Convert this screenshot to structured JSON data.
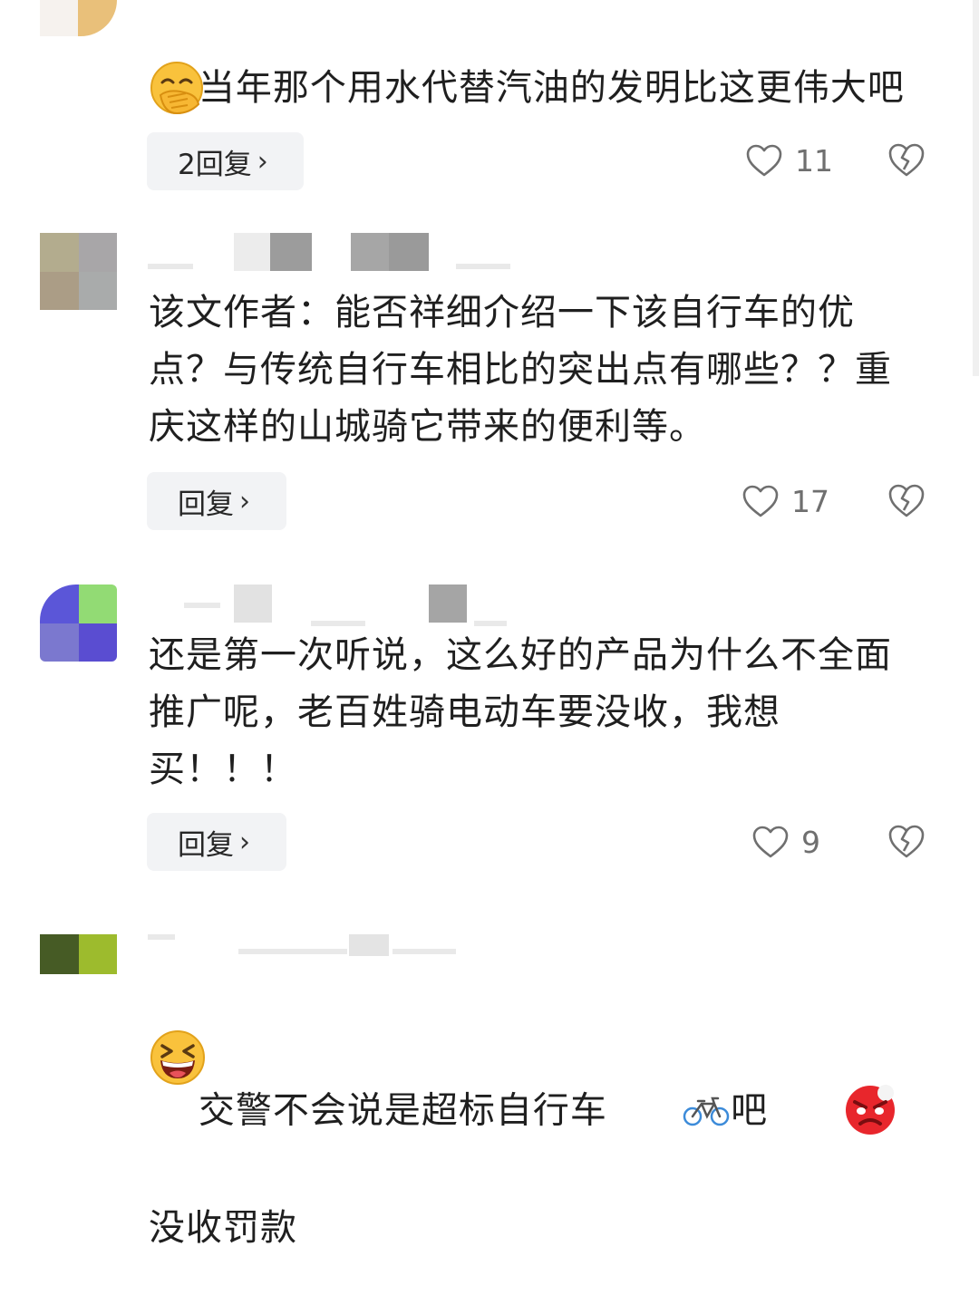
{
  "comments": [
    {
      "text": "当年那个用水代替汽油的发明比这更伟大吧",
      "emoji": "hand-over-mouth-emoji",
      "reply_label": "2回复",
      "likes": "11"
    },
    {
      "text": "该文作者：能否祥细介绍一下该自行车的优点？与传统自行车相比的突出点有哪些？？重庆这样的山城骑它带来的便利等。",
      "reply_label": "回复",
      "likes": "17"
    },
    {
      "text": "还是第一次听说，这么好的产品为什么不全面推广呢，老百姓骑电动车要没收，我想买！！！",
      "reply_label": "回复",
      "likes": "9"
    },
    {
      "text_parts": [
        "交警不会说是超标自行车",
        "吧",
        "没收罚款"
      ],
      "emojis": [
        "bicycle-emoji",
        "angry-face-emoji",
        "grinning-squinting-emoji"
      ]
    }
  ],
  "colors": {
    "reply_bg": "#f2f3f5",
    "text": "#1f1f1f",
    "meta": "#6f6f6f"
  }
}
